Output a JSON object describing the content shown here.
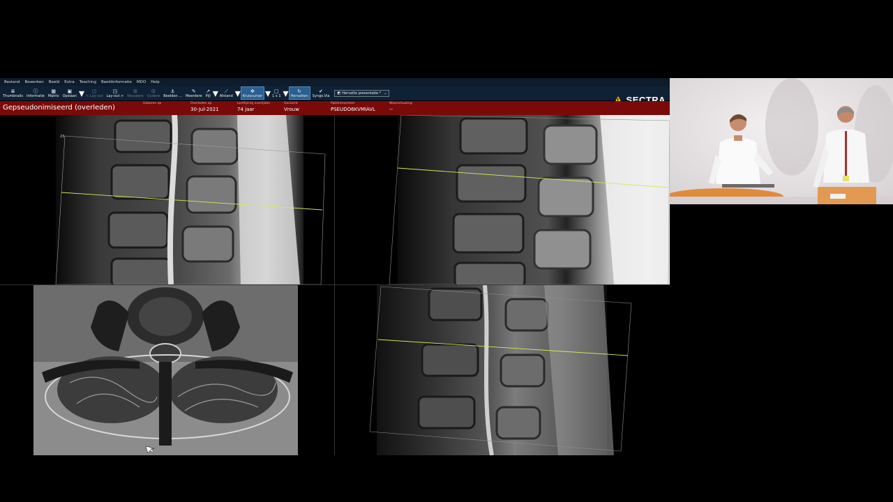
{
  "menu": [
    "Bestand",
    "Bewerken",
    "Beeld",
    "Extra",
    "Teaching",
    "Beeldinformatie",
    "MDO",
    "Help"
  ],
  "toolbar": {
    "items": [
      {
        "label": "Thumbnails",
        "icon": "≣"
      },
      {
        "label": "Informatie",
        "icon": "ⓘ"
      },
      {
        "label": "Matrix",
        "icon": "▦"
      },
      {
        "label": "Opslaan",
        "icon": "▣"
      },
      {
        "label": "< Lay-out",
        "icon": "◰"
      },
      {
        "label": "Lay-out >",
        "icon": "◳"
      },
      {
        "label": "Nieuwere",
        "icon": "⊞"
      },
      {
        "label": "Oudere",
        "icon": "⊟"
      },
      {
        "label": "Beelden ...",
        "icon": "⚓"
      },
      {
        "label": "Meerdere",
        "icon": "✎"
      },
      {
        "label": "Pijl",
        "icon": "↗"
      },
      {
        "label": "Afstand",
        "icon": "⟋"
      },
      {
        "label": "Kruiscursor",
        "icon": "✥"
      },
      {
        "label": "1 x 1",
        "icon": "□"
      },
      {
        "label": "Hervatten",
        "icon": "↻"
      },
      {
        "label": "Syngo.Via",
        "icon": "✔"
      }
    ],
    "presentation_dropdown": "Hervatte presentatie *",
    "brand": "SECTRA"
  },
  "patient": {
    "name": "Gepseudonimiseerd (overleden)",
    "fields": [
      {
        "key": "Geboren op",
        "value": ""
      },
      {
        "key": "Overleden op",
        "value": "30-Jul-2021"
      },
      {
        "key": "Leeftijd bij overlijden",
        "value": "74 jaar"
      },
      {
        "key": "Geslacht",
        "value": "Vrouw"
      },
      {
        "key": "Patiëntnummer",
        "value": "PSEUDO6KVMIAVL"
      },
      {
        "key": "Waarschuwing",
        "value": "--"
      }
    ]
  },
  "viewports": {
    "top_left_marker": "23"
  },
  "colors": {
    "patient_bar": "#7a0a0a",
    "toolbar": "#0f2235",
    "reference_line": "#d8e85a"
  }
}
